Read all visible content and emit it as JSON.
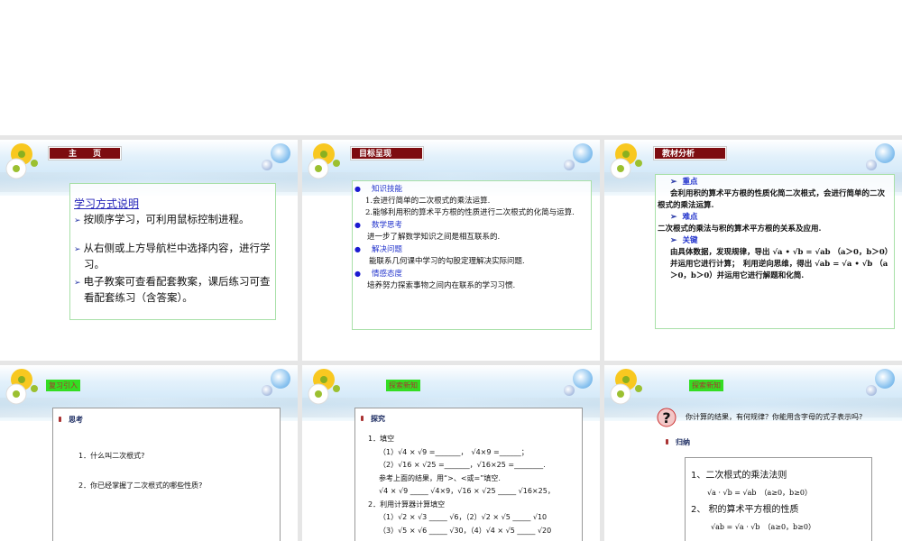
{
  "slides": [
    {
      "title": "主　　页",
      "heading": "学习方式说明",
      "bullets": [
        "按顺序学习，可利用鼠标控制进程。",
        "从右侧或上方导航栏中选择内容，进行学习。",
        "电子教案可查看配套教案，课后练习可查看配套练习（含答案）。"
      ]
    },
    {
      "title": "目标呈现",
      "sections": [
        {
          "label": "知识技能",
          "lines": [
            "1.会进行简单的二次根式的乘法运算.",
            "2.能够利用积的算术平方根的性质进行二次根式的化简与运算."
          ]
        },
        {
          "label": "数学思考",
          "lines": [
            "进一步了解数学知识之间是相互联系的."
          ]
        },
        {
          "label": "解决问题",
          "lines": [
            "能联系几何课中学习的勾股定理解决实际问题."
          ]
        },
        {
          "label": "情感态度",
          "lines": [
            "培养努力探索事物之间内在联系的学习习惯."
          ]
        }
      ]
    },
    {
      "title": "教材分析",
      "sections": [
        {
          "label": "重点",
          "text": "会利用积的算术平方根的性质化简二次根式，会进行简单的二次根式的乘法运算."
        },
        {
          "label": "难点",
          "text": "二次根式的乘法与积的算术平方根的关系及应用."
        },
        {
          "label": "关键",
          "text": "由具体数据，发现规律，导出 √a • √b = √ab （a＞0，b＞0）并运用它进行计算；　利用逆向思维，得出 √ab = √a • √b （a＞0，b＞0）并运用它进行解题和化简."
        }
      ]
    },
    {
      "title": "复习引入",
      "heading": "思考",
      "questions": [
        "1．什么叫二次根式?",
        "2．你已经掌握了二次根式的哪些性质?"
      ]
    },
    {
      "title": "探索新知",
      "heading": "探究",
      "lines": [
        "1．填空",
        "（1）√4 × √9 =_______，　√4×9 =______；",
        "（2）√16 × √25 =_______，√16×25 =________.",
        "参考上面的结果，用“>、<或=”填空.",
        "√4 × √9 _____ √4×9，√16 × √25 _____ √16×25，",
        "2．利用计算器计算填空",
        "（1）√2 × √3 _____ √6，（2）√2 × √5 _____ √10",
        "（3）√5 × √6 _____ √30，（4）√4 × √5 _____ √20"
      ]
    },
    {
      "title": "探索新知",
      "question": "你计算的结果，有何规律？你能用含字母的式子表示吗?",
      "heading": "归纳",
      "rules": [
        "1、二次根式的乘法法则",
        "√a · √b = √ab　（a≥0，b≥0）",
        "2、 积的算术平方根的性质",
        "√ab = √a · √b　（a≥0，b≥0）"
      ]
    }
  ]
}
